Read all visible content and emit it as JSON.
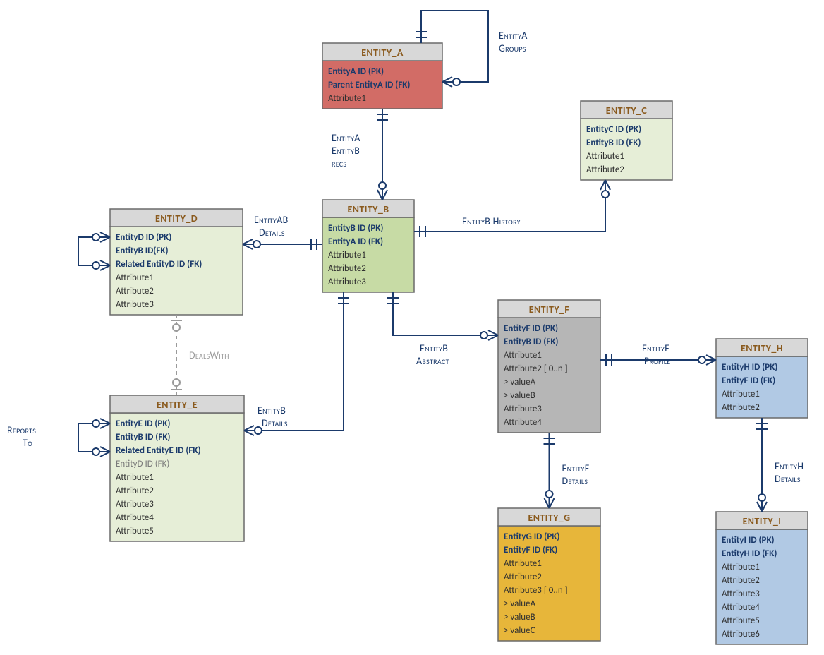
{
  "entities": {
    "A": {
      "name": "ENTITY_A",
      "bodyColor": "#d26c66",
      "attrs": [
        {
          "t": "EntityA ID (PK)",
          "k": "key"
        },
        {
          "t": "Parent EntityA ID (FK)",
          "k": "key"
        },
        {
          "t": "Attribute1",
          "k": "plain"
        }
      ]
    },
    "B": {
      "name": "ENTITY_B",
      "bodyColor": "#c7dba5",
      "attrs": [
        {
          "t": "EntityB ID (PK)",
          "k": "key"
        },
        {
          "t": "EntityA ID (FK)",
          "k": "key"
        },
        {
          "t": "Attribute1",
          "k": "plain"
        },
        {
          "t": "Attribute2",
          "k": "plain"
        },
        {
          "t": "Attribute3",
          "k": "plain"
        }
      ]
    },
    "C": {
      "name": "ENTITY_C",
      "bodyColor": "#e6eed7",
      "attrs": [
        {
          "t": "EntityC ID (PK)",
          "k": "key"
        },
        {
          "t": "EntityB ID (FK)",
          "k": "key"
        },
        {
          "t": "Attribute1",
          "k": "plain"
        },
        {
          "t": "Attribute2",
          "k": "plain"
        }
      ]
    },
    "D": {
      "name": "ENTITY_D",
      "bodyColor": "#e6eed7",
      "attrs": [
        {
          "t": "EntityD ID (PK)",
          "k": "key"
        },
        {
          "t": "EntityB ID(FK)",
          "k": "key"
        },
        {
          "t": "Related EntityD ID (FK)",
          "k": "key"
        },
        {
          "t": "Attribute1",
          "k": "plain"
        },
        {
          "t": "Attribute2",
          "k": "plain"
        },
        {
          "t": "Attribute3",
          "k": "plain"
        }
      ]
    },
    "E": {
      "name": "ENTITY_E",
      "bodyColor": "#e6eed7",
      "attrs": [
        {
          "t": "EntityE ID (PK)",
          "k": "key"
        },
        {
          "t": "EntityB ID (FK)",
          "k": "key"
        },
        {
          "t": "Related EntityE ID (FK)",
          "k": "key"
        },
        {
          "t": "EntityD ID (FK)",
          "k": "fkgrey"
        },
        {
          "t": "Attribute1",
          "k": "plain"
        },
        {
          "t": "Attribute2",
          "k": "plain"
        },
        {
          "t": "Attribute3",
          "k": "plain"
        },
        {
          "t": "Attribute4",
          "k": "plain"
        },
        {
          "t": "Attribute5",
          "k": "plain"
        }
      ]
    },
    "F": {
      "name": "ENTITY_F",
      "bodyColor": "#b6b6b6",
      "attrs": [
        {
          "t": "EntityF ID (PK)",
          "k": "key"
        },
        {
          "t": "EntityB ID (FK)",
          "k": "key"
        },
        {
          "t": "Attribute1",
          "k": "plain"
        },
        {
          "t": "Attribute2 [ 0..n ]",
          "k": "plain"
        },
        {
          "t": " > valueA",
          "k": "plain"
        },
        {
          "t": " > valueB",
          "k": "plain"
        },
        {
          "t": "Attribute3",
          "k": "plain"
        },
        {
          "t": "Attribute4",
          "k": "plain"
        }
      ]
    },
    "G": {
      "name": "ENTITY_G",
      "bodyColor": "#e7b63a",
      "attrs": [
        {
          "t": "EntityG ID (PK)",
          "k": "key"
        },
        {
          "t": "EntityF ID (FK)",
          "k": "key"
        },
        {
          "t": "Attribute1",
          "k": "plain"
        },
        {
          "t": "Attribute2",
          "k": "plain"
        },
        {
          "t": "Attribute3 [ 0..n ]",
          "k": "plain"
        },
        {
          "t": " > valueA",
          "k": "plain"
        },
        {
          "t": " > valueB",
          "k": "plain"
        },
        {
          "t": " > valueC",
          "k": "plain"
        }
      ]
    },
    "H": {
      "name": "ENTITY_H",
      "bodyColor": "#b1c9e4",
      "attrs": [
        {
          "t": "EntityH ID (PK)",
          "k": "key"
        },
        {
          "t": "EntityF ID (FK)",
          "k": "key"
        },
        {
          "t": "Attribute1",
          "k": "plain"
        },
        {
          "t": "Attribute2",
          "k": "plain"
        }
      ]
    },
    "I": {
      "name": "ENTITY_I",
      "bodyColor": "#b1c9e4",
      "attrs": [
        {
          "t": "EntityI ID (PK)",
          "k": "key"
        },
        {
          "t": "EntityH  ID (FK)",
          "k": "key"
        },
        {
          "t": "Attribute1",
          "k": "plain"
        },
        {
          "t": "Attribute2",
          "k": "plain"
        },
        {
          "t": "Attribute3",
          "k": "plain"
        },
        {
          "t": "Attribute4",
          "k": "plain"
        },
        {
          "t": "Attribute5",
          "k": "plain"
        },
        {
          "t": "Attribute6",
          "k": "plain"
        }
      ]
    }
  },
  "relLabels": {
    "AGroups1": "EntityA",
    "AGroups2": "Groups",
    "ABrecs1": "EntityA",
    "ABrecs2": "EntityB",
    "ABrecs3": "recs",
    "BHist": "EntityB History",
    "ABDet1": "EntityAB",
    "ABDet2": "Details",
    "DealsWith": "DealsWith",
    "BDet1": "EntityB",
    "BDet2": "Details",
    "BAbs1": "EntityB",
    "BAbs2": "Abstract",
    "FProf1": "EntityF",
    "FProf2": "Profile",
    "FDet1": "EntityF",
    "FDet2": "Details",
    "HDet1": "EntityH",
    "HDet2": "Details",
    "RepTo1": "Reports",
    "RepTo2": "To"
  }
}
